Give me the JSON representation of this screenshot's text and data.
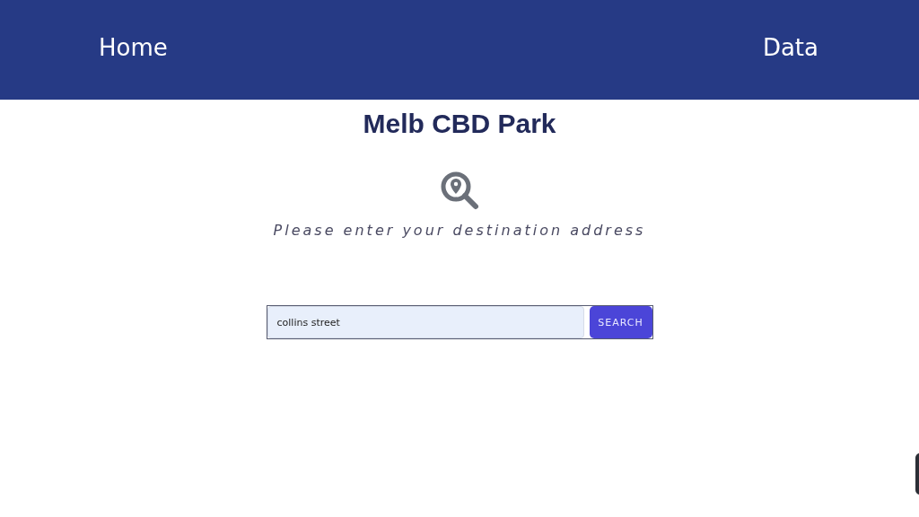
{
  "nav": [
    {
      "label": "Home"
    },
    {
      "label": "Data"
    }
  ],
  "title": "Melb CBD Park",
  "subtitle": "Please enter your destination address",
  "search": {
    "value": "collins street",
    "button": "SEARCH"
  }
}
